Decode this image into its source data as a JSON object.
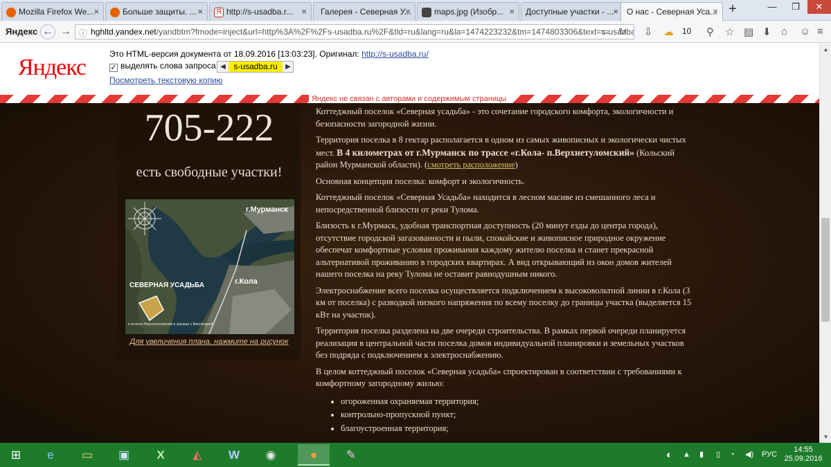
{
  "browser": {
    "tabs": [
      {
        "label": "Mozilla Firefox We...",
        "color": "#e66000"
      },
      {
        "label": "Больше защиты. ...",
        "color": "#e66000"
      },
      {
        "label": "http://s-usadba.r...",
        "color": "#cc2222"
      },
      {
        "label": "Галерея - Северная У...",
        "color": "#9aa3b0"
      },
      {
        "label": "maps.jpg (Изобр...",
        "color": "#555555"
      },
      {
        "label": "Доступные участки - ...",
        "color": "#9aa3b0"
      },
      {
        "label": "О нас - Северная Уса...",
        "color": "#9aa3b0"
      }
    ],
    "brand_label": "Яндекс",
    "url_host": "hghltd.yandex.net",
    "url_rest": "/yandbtm?fmode=inject&url=http%3A%2F%2Fs-usadba.ru%2F&tld=ru&lang=ru&la=1474223232&tm=1474803306&text=s-usadba.ru&",
    "weather_temp": "10"
  },
  "cache_header": {
    "logo": "Яндекс",
    "version_text": "Это HTML-версия документа от 18.09.2016 [13:03:23]. Оригинал:",
    "original_link": "http://s-usadba.ru/",
    "highlight_label": "выделять слова запроса:",
    "query_word": "s-usadba.ru",
    "text_copy_link": "Посмотреть текстовую копию",
    "disclaimer": "Яндекс не связан с авторами и содержимым страницы"
  },
  "sidebar": {
    "phone": "705-222",
    "free_plots": "есть свободные участки!",
    "map_label_murmansk": "г.Мурманск",
    "map_label_kola": "г.Кола",
    "map_label_estate": "СЕВЕРНАЯ УСАДЬБА",
    "map_small_text": "к поселку Верхнетуломский и границе с Финляндией",
    "map_caption": "Для увеличения плана, нажмите на рисунок"
  },
  "content": {
    "p1": "Коттеджный поселок «Северная усадьба» - это сочетание городского комфорта, экологичности и безопасности загородной жизни.",
    "p2_start": "Территория поселка в 8 гектар располагается в одном из самых живописных и экологически чистых мест.",
    "p2_bold": "В 4 километрах от г.Мурманск по трассе «г.Кола- п.Верхнетуломский»",
    "p2_end": "(Кольский район Мурманской области). (",
    "p2_link": "смотреть расположение",
    "p2_close": ")",
    "p3": "Основная концепция поселка: комфорт и экологичность.",
    "p4": "Коттеджный поселок «Северная Усадьба» находится в лесном масиве из смешанного леса и непосредственной близости от реки Тулома.",
    "p5": "Близость к г.Мурмаск, удобная транспортная доступность (20 минут езды до центра города), отсутствие городской загазованности и пыли, спокойские и живописное природное окружение обеспечат комфортные условия проживания каждому жителю поселка и станет прекрасной альтернативой проживанию в городских квартирах. А вид открывающий из окон домов жителей нашего поселка на реку Тулома не оставит равнодушным никого.",
    "p6": "Электроснабжение всего поселка осуществляется подключением к высоковольтной линии в г.Кола (3 км от поселка) с разводкой низкого напряжения по всему поселку до границы участка (выделяется 15 кВт на участок).",
    "p7": "Территория поселка разделена на две очереди строительства. В рамках первой очереди планируется реализация в центральной части поселка домов индивидуальной планировки и земельных участков без подряда с подключением к электроснабжению.",
    "p8": "В целом коттеджный поселок «Северная усадьба» спроектирован в соответствии с требованиями к комфортному загородному жилью:",
    "list": [
      "огороженная охраняемая территория;",
      "контрольно-пропускной пункт;",
      "благоустроенная территория;"
    ]
  },
  "taskbar": {
    "lang": "РУС",
    "time": "14:55",
    "date": "25.09.2016"
  }
}
